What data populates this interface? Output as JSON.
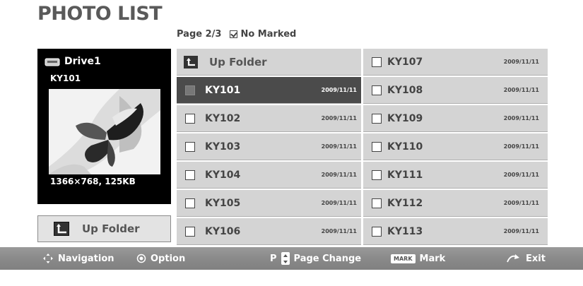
{
  "header": {
    "title": "PHOTO LIST",
    "page": "Page 2/3",
    "marked": "No Marked"
  },
  "preview": {
    "drive": "Drive1",
    "filename": "KY101",
    "meta": "1366×768, 125KB"
  },
  "up_folder_button": "Up Folder",
  "list": {
    "up_folder": "Up Folder",
    "left": [
      {
        "name": "KY101",
        "date": "2009/11/11"
      },
      {
        "name": "KY102",
        "date": "2009/11/11"
      },
      {
        "name": "KY103",
        "date": "2009/11/11"
      },
      {
        "name": "KY104",
        "date": "2009/11/11"
      },
      {
        "name": "KY105",
        "date": "2009/11/11"
      },
      {
        "name": "KY106",
        "date": "2009/11/11"
      }
    ],
    "right": [
      {
        "name": "KY107",
        "date": "2009/11/11"
      },
      {
        "name": "KY108",
        "date": "2009/11/11"
      },
      {
        "name": "KY109",
        "date": "2009/11/11"
      },
      {
        "name": "KY110",
        "date": "2009/11/11"
      },
      {
        "name": "KY111",
        "date": "2009/11/11"
      },
      {
        "name": "KY112",
        "date": "2009/11/11"
      },
      {
        "name": "KY113",
        "date": "2009/11/11"
      }
    ]
  },
  "footer": {
    "navigation": "Navigation",
    "option": "Option",
    "page_prefix": "P",
    "page_change": "Page Change",
    "mark_badge": "MARK",
    "mark": "Mark",
    "exit": "Exit"
  },
  "colors": {
    "selected_row": "#4b4b4b",
    "row": "#d4d4d4",
    "bottom_bar": "#8a8a8a"
  }
}
